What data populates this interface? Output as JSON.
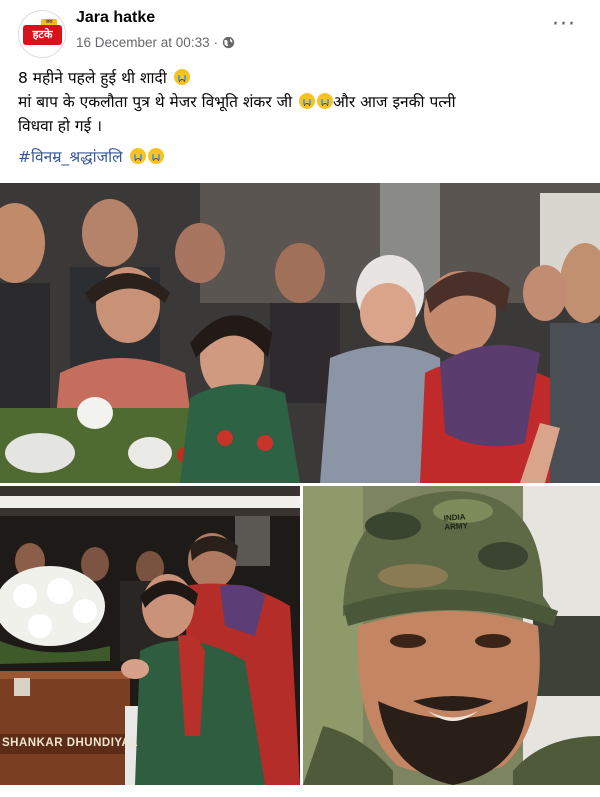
{
  "post": {
    "page_name": "Jara hatke",
    "avatar_logo_text": "हटके",
    "avatar_logo_badge": "जरा",
    "timestamp": "16 December at 00:33",
    "separator": "·",
    "more_label": "···",
    "text_line1": "8 महीने पहले हुई थी शादी",
    "text_line2a": "मां बाप के एकलौता पुत्र थे मेजर विभूति शंकर जी",
    "text_line2b": "और आज इनकी पत्नी",
    "text_line3": "विधवा हो गई ।",
    "hashtag": "#विनम्र_श्रद्धांजलि"
  },
  "photos": {
    "casket_text": "SHANKAR DHUNDIYAL",
    "cap_text": "INDIA\nARMY"
  },
  "icons": {
    "audience": "globe-icon",
    "menu": "more-options-icon",
    "emoji": [
      "crying-face-icon",
      "loudly-crying-face-icon"
    ]
  },
  "colors": {
    "link": "#385898",
    "secondary_text": "#65676b",
    "brand_red": "#d6121a"
  }
}
